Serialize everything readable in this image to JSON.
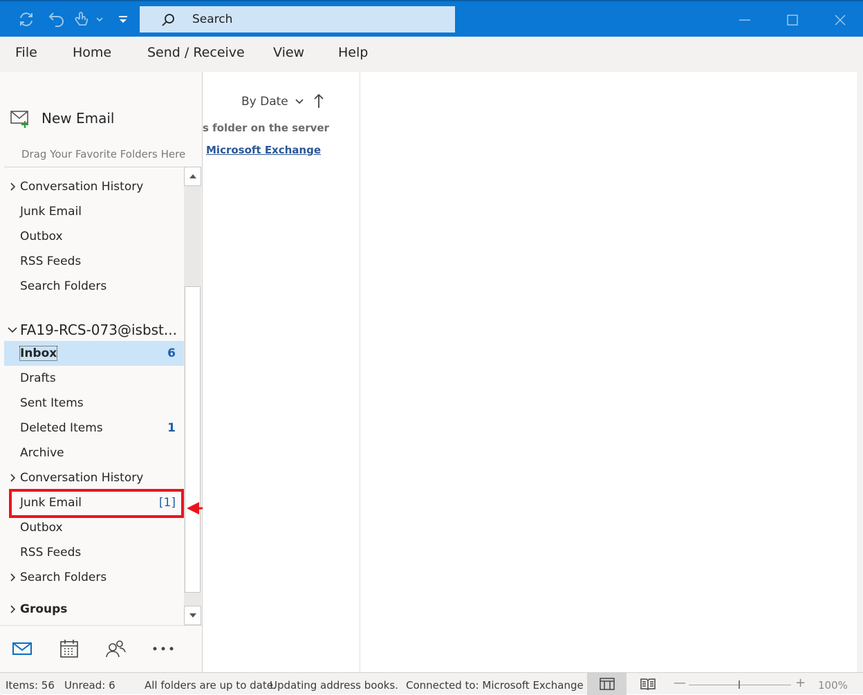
{
  "titlebar": {
    "search_label": "Search",
    "icons": [
      "sync-icon",
      "undo-icon",
      "touch-mode-icon",
      "chevron-down-icon",
      "customize-toolbar-icon",
      "search-icon",
      "minimize-icon",
      "maximize-icon",
      "close-icon"
    ],
    "accent_color": "#0a78d4"
  },
  "menu": {
    "file": "File",
    "home": "Home",
    "send_receive": "Send / Receive",
    "view": "View",
    "help": "Help"
  },
  "leftpane": {
    "new_email": "New Email",
    "drag_favorites": "Drag Your Favorite Folders Here",
    "top_folders": [
      {
        "label": "Conversation History",
        "expandable": true
      },
      {
        "label": "Junk Email"
      },
      {
        "label": "Outbox"
      },
      {
        "label": "RSS Feeds"
      },
      {
        "label": "Search Folders"
      }
    ],
    "account": "FA19-RCS-073@isbst...",
    "folders": {
      "inbox": {
        "label": "Inbox",
        "count": "6"
      },
      "drafts": {
        "label": "Drafts"
      },
      "sent": {
        "label": "Sent Items"
      },
      "deleted": {
        "label": "Deleted Items",
        "count": "1"
      },
      "archive": {
        "label": "Archive"
      },
      "conversation": {
        "label": "Conversation History"
      },
      "junk": {
        "label": "Junk Email",
        "count": "[1]"
      },
      "outbox": {
        "label": "Outbox"
      },
      "rss": {
        "label": "RSS Feeds"
      },
      "search": {
        "label": "Search Folders"
      }
    },
    "groups": "Groups",
    "nav_icons": [
      "mail-icon",
      "calendar-icon",
      "people-icon",
      "more-icon"
    ],
    "highlight_color": "#e8151b"
  },
  "msglist": {
    "sort_label": "By Date",
    "server_msg": "s folder on the server",
    "exchange_link": "Microsoft Exchange"
  },
  "status": {
    "items": "Items: 56",
    "unread": "Unread: 6",
    "sync": "All folders are up to date.",
    "updating": "Updating address books.",
    "connected": "Connected to: Microsoft Exchange",
    "zoom_minus": "—",
    "zoom_plus": "+",
    "zoom": "100%"
  }
}
